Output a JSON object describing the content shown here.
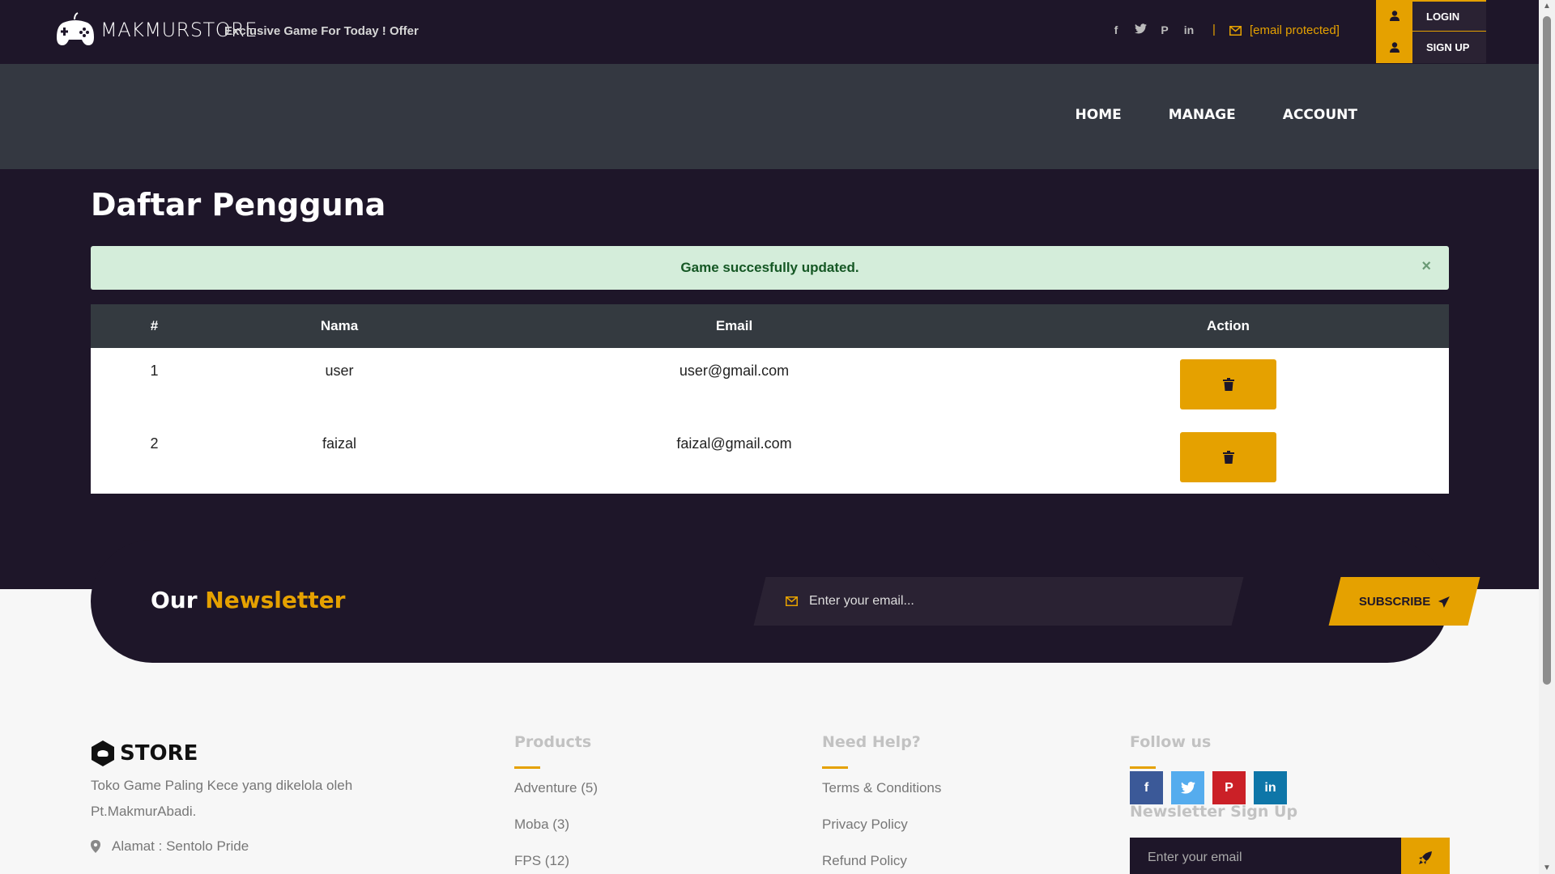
{
  "header": {
    "brand": "MAKMURSTORE",
    "tagline": "Exclusive Game For Today ! Offer",
    "separator": "|",
    "email": "[email protected]",
    "social_icons": [
      "facebook-icon",
      "twitter-icon",
      "pinterest-icon",
      "linkedin-icon"
    ],
    "login_label": "LOGIN",
    "signup_label": "SIGN UP"
  },
  "nav": {
    "items": [
      {
        "label": "HOME"
      },
      {
        "label": "MANAGE"
      },
      {
        "label": "ACCOUNT"
      }
    ]
  },
  "page": {
    "title": "Daftar Pengguna",
    "alert": "Game succesfully updated.",
    "alert_close": "×"
  },
  "table": {
    "headers": [
      "#",
      "Nama",
      "Email",
      "Action"
    ],
    "rows": [
      {
        "no": "1",
        "nama": "user",
        "email": "user@gmail.com"
      },
      {
        "no": "2",
        "nama": "faizal",
        "email": "faizal@gmail.com"
      }
    ]
  },
  "newsletter": {
    "title_plain": "Our",
    "title_accent": "Newsletter",
    "placeholder": "Enter your email...",
    "button": "SUBSCRIBE"
  },
  "footer": {
    "logo_text": "STORE",
    "description": "Toko Game Paling Kece yang dikelola oleh Pt.MakmurAbadi.",
    "address": "Alamat : Sentolo Pride",
    "products": {
      "title": "Products",
      "items": [
        "Adventure (5)",
        "Moba (3)",
        "FPS (12)"
      ]
    },
    "help": {
      "title": "Need Help?",
      "items": [
        "Terms & Conditions",
        "Privacy Policy",
        "Refund Policy"
      ]
    },
    "follow": {
      "title": "Follow us",
      "icons": [
        "facebook-icon",
        "twitter-icon",
        "pinterest-icon",
        "linkedin-icon"
      ]
    },
    "newsletter_signup": {
      "title": "Newsletter Sign Up",
      "placeholder": "Enter your email"
    }
  },
  "colors": {
    "accent": "#e5a100",
    "dark": "#1e1629",
    "nav": "#343841",
    "alert_bg": "#d4edda",
    "alert_text": "#155724",
    "facebook": "#3b5998",
    "twitter": "#55acee",
    "pinterest": "#cb2027",
    "linkedin": "#0e76a8"
  }
}
